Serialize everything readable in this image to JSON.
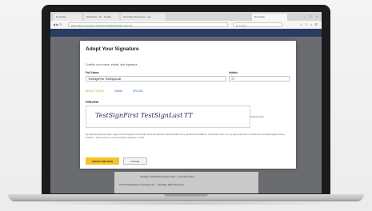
{
  "browser": {
    "tabs": [
      {
        "label": "DocuSign"
      },
      {
        "label": "Wikipedia - Ri... Facility"
      },
      {
        "label": "DocuSign Resources...ap..."
      },
      {
        "label": "DocuSign"
      }
    ],
    "address": "https://demo.docusign.net/Signing/StartInSession.aspx?t=...",
    "search_placeholder": "DocuSign"
  },
  "modal": {
    "title": "Adopt Your Signature",
    "subtitle": "Confirm your name, initials, and signature.",
    "full_name_label": "Full Name",
    "full_name_value": "TestSignFirst TestSignLast",
    "initials_label": "Initials",
    "initials_value": "TT",
    "style_options": [
      "SELECT STYLE",
      "DRAW",
      "UPLOAD"
    ],
    "preview_label": "PREVIEW",
    "signature_preview": "TestSignFirst TestSignLast",
    "initials_preview": "TT",
    "change_style_label": "Change Style",
    "legal_text": "By selecting Adopt and Sign, I agree that the signature and initials will be the electronic representation of my signature and initials for all purposes when I (or my agent) use them on documents, including legally binding contracts - just the same as a pen-and-paper signature or initial.",
    "adopt_label": "ADOPT AND SIGN",
    "cancel_label": "CANCEL"
  },
  "background_doc": {
    "line1": "TestSign 228 Hollow Dollars Cha...  Contract Notice",
    "line2": "NTLM  TestSignFirst TestSignLast  ...  TestSign 228 Hollow Dol"
  },
  "colors": {
    "accent": "#f5c327",
    "header": "#2b3c63",
    "link": "#2c6ac8"
  }
}
